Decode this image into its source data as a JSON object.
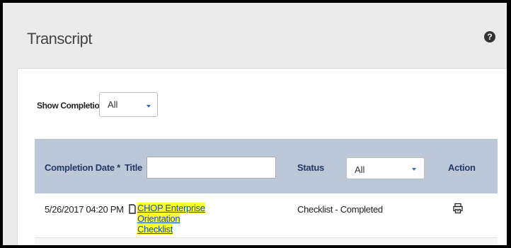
{
  "header": {
    "title": "Transcript",
    "help_glyph": "?"
  },
  "filter": {
    "label": "Show Completions:",
    "value": "All"
  },
  "table": {
    "columns": {
      "completion_date": "Completion Date *",
      "title": "Title",
      "status": "Status",
      "action": "Action"
    },
    "title_filter_value": "",
    "status_filter_value": "All",
    "rows": [
      {
        "date": "5/26/2017 04:20 PM",
        "title_line1": "CHOP Enterprise Orientation",
        "title_line2": "Checklist",
        "status": "Checklist - Completed"
      }
    ]
  },
  "colors": {
    "header_bg": "#bcc7d8",
    "link": "#1a4fa0",
    "highlight": "#fbff3a",
    "caret": "#3a6fb0"
  }
}
